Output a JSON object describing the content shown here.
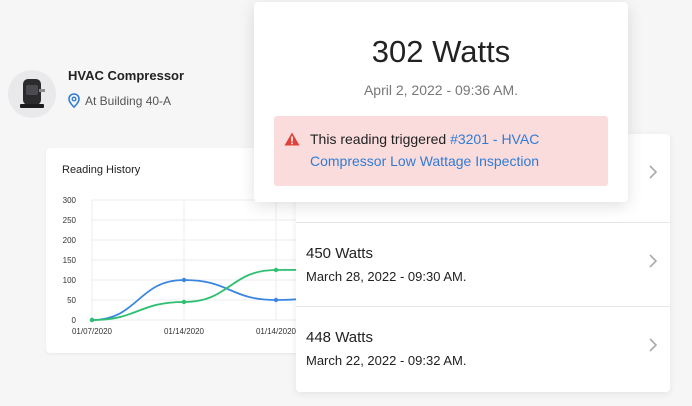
{
  "asset": {
    "name": "HVAC Compressor",
    "location": "At Building 40-A"
  },
  "current_reading": {
    "watts": "302 Watts",
    "date": "April 2, 2022 - 09:36 AM.",
    "alert_prefix": "This reading triggered ",
    "alert_link": "#3201 - HVAC Compressor Low Wattage Inspection"
  },
  "readings": [
    {
      "watts": "450 Watts",
      "date": "March 28, 2022 - 09:30 AM."
    },
    {
      "watts": "448 Watts",
      "date": "March 22, 2022 - 09:32 AM."
    }
  ],
  "colors": {
    "blue_series": "#3a86e0",
    "green_series": "#2fbf71",
    "alert_bg": "#fbdcdc",
    "alert_icon": "#e0413a",
    "link": "#2f7bd6"
  },
  "chart_data": {
    "type": "line",
    "title": "Reading History",
    "y_ticks": [
      "300",
      "250",
      "200",
      "150",
      "100",
      "50",
      "0"
    ],
    "ylim": [
      0,
      300
    ],
    "x_ticks": [
      "01/07/2020",
      "01/14/2020",
      "01/14/2020"
    ],
    "grid": true,
    "series": [
      {
        "values": [
          0,
          100,
          50,
          70
        ]
      },
      {
        "values": [
          0,
          45,
          125,
          130
        ]
      }
    ]
  }
}
